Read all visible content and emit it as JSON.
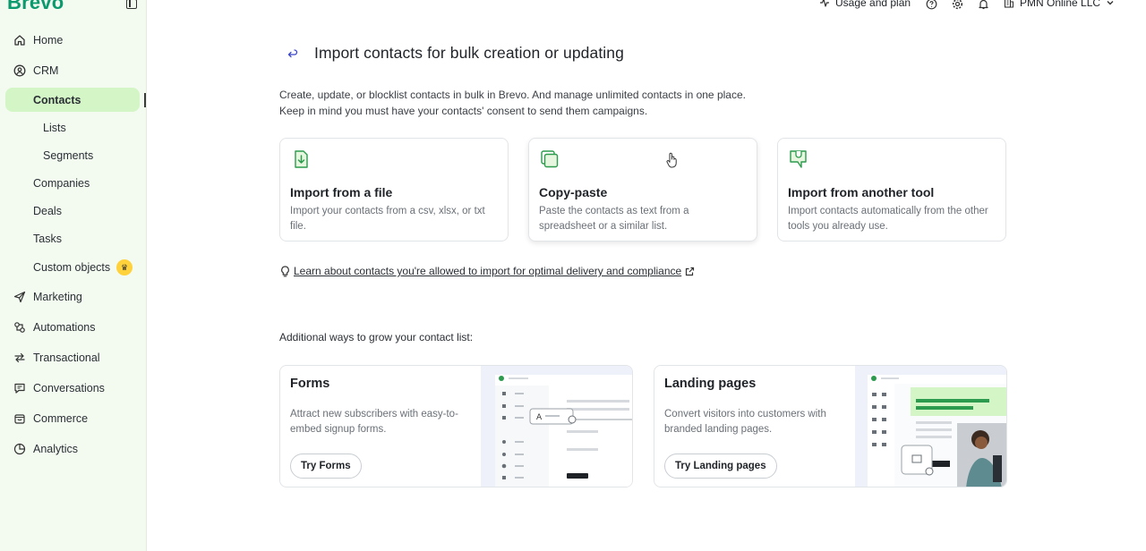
{
  "brand": {
    "logo": "Brevo"
  },
  "sidebar": {
    "items": [
      {
        "label": "Home",
        "icon": "home-icon"
      },
      {
        "label": "CRM",
        "icon": "crm-icon"
      },
      {
        "label": "Contacts"
      },
      {
        "label": "Lists"
      },
      {
        "label": "Segments"
      },
      {
        "label": "Companies"
      },
      {
        "label": "Deals"
      },
      {
        "label": "Tasks"
      },
      {
        "label": "Custom objects",
        "badge": "crown-icon"
      },
      {
        "label": "Marketing",
        "icon": "paper-plane-icon"
      },
      {
        "label": "Automations",
        "icon": "automations-icon"
      },
      {
        "label": "Transactional",
        "icon": "arrows-icon"
      },
      {
        "label": "Conversations",
        "icon": "chat-icon"
      },
      {
        "label": "Commerce",
        "icon": "bag-icon"
      },
      {
        "label": "Analytics",
        "icon": "pie-chart-icon"
      }
    ]
  },
  "topbar": {
    "usage": "Usage and plan",
    "account": "PMN Online LLC"
  },
  "main": {
    "title": "Import contacts for bulk creation or updating",
    "intro_line1": "Create, update, or blocklist contacts in bulk in Brevo. And manage unlimited contacts in one place.",
    "intro_line2": "Keep in mind you must have your contacts' consent to send them campaigns.",
    "cards": [
      {
        "title": "Import from a file",
        "desc": "Import your contacts from a csv, xlsx, or txt file.",
        "icon": "file-import-icon"
      },
      {
        "title": "Copy-paste",
        "desc": "Paste the contacts as text from a spreadsheet or a similar list.",
        "icon": "copy-icon"
      },
      {
        "title": "Import from another tool",
        "desc": "Import contacts automatically from the other tools you already use.",
        "icon": "plug-icon"
      }
    ],
    "learn_link": "Learn about contacts you're allowed to import for optimal delivery and compliance",
    "section_label": "Additional ways to grow your contact list:",
    "grow": [
      {
        "title": "Forms",
        "desc": "Attract new subscribers with easy-to-embed signup forms.",
        "button": "Try Forms"
      },
      {
        "title": "Landing pages",
        "desc": "Convert visitors into customers with branded landing pages.",
        "button": "Try Landing pages"
      }
    ]
  },
  "colors": {
    "sidebar_bg": "#f3fbf1",
    "active_bg": "#d4f5c5",
    "brand_green": "#0b996e",
    "icon_green": "#2c9b4d"
  }
}
